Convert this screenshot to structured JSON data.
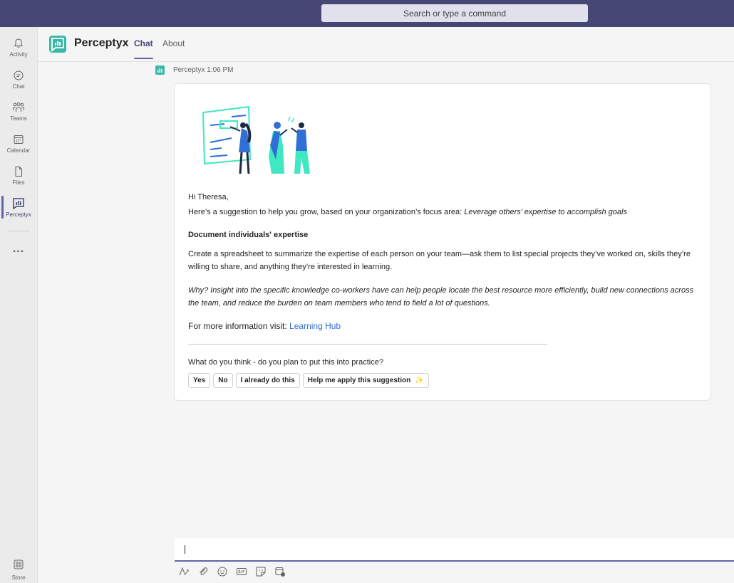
{
  "search": {
    "placeholder": "Search or type a command"
  },
  "rail": {
    "items": [
      {
        "label": "Activity",
        "icon": "bell-icon"
      },
      {
        "label": "Chat",
        "icon": "chat-icon"
      },
      {
        "label": "Teams",
        "icon": "teams-icon"
      },
      {
        "label": "Calendar",
        "icon": "calendar-icon"
      },
      {
        "label": "Files",
        "icon": "file-icon"
      },
      {
        "label": "Perceptyx",
        "icon": "perceptyx-icon",
        "active": true
      }
    ],
    "more": "...",
    "store": "Store"
  },
  "header": {
    "app_name": "Perceptyx",
    "tabs": [
      {
        "label": "Chat",
        "active": true
      },
      {
        "label": "About"
      }
    ]
  },
  "message": {
    "sender": "Perceptyx",
    "time": "1:06 PM",
    "greeting": "Hi Theresa,",
    "intro_prefix": "Here’s a suggestion to help you grow, based on your organization’s focus area: ",
    "intro_focus": "Leverage others’ expertise to accomplish goals",
    "heading": "Document individuals' expertise",
    "body": "Create a spreadsheet to summarize the expertise of each person on your team—ask them to list special projects they’ve worked on, skills they’re willing to share, and anything they’re interested in learning.",
    "why": "Why? Insight into the specific knowledge co-workers have can help people locate the best resource more efficiently, build new connections across the team, and reduce the burden on team members who tend to field a lot of questions.",
    "more_info_prefix": "For more information visit: ",
    "more_info_link": "Learning Hub",
    "question": "What do you think - do you plan to put this into practice?",
    "buttons": [
      "Yes",
      "No",
      "I already do this",
      "Help me apply this suggestion"
    ],
    "sparkle": "✨"
  },
  "colors": {
    "topbar": "#464775",
    "accent": "#6264a7",
    "app_teal": "#3bb8a8",
    "link": "#2f6fd6"
  }
}
